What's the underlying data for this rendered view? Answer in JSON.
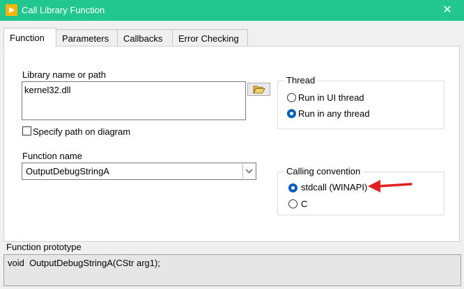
{
  "window": {
    "title": "Call Library Function",
    "close_glyph": "✕"
  },
  "tabs": [
    {
      "label": "Function",
      "active": true
    },
    {
      "label": "Parameters",
      "active": false
    },
    {
      "label": "Callbacks",
      "active": false
    },
    {
      "label": "Error Checking",
      "active": false
    }
  ],
  "function_tab": {
    "library": {
      "label": "Library name or path",
      "value": "kernel32.dll"
    },
    "specify_path": {
      "label": "Specify path on diagram",
      "checked": false
    },
    "function_name": {
      "label": "Function name",
      "value": "OutputDebugStringA"
    },
    "thread": {
      "title": "Thread",
      "options": [
        {
          "label": "Run in UI thread",
          "checked": false
        },
        {
          "label": "Run in any thread",
          "checked": true
        }
      ]
    },
    "calling_convention": {
      "title": "Calling convention",
      "options": [
        {
          "label": "stdcall (WINAPI)",
          "checked": true
        },
        {
          "label": "C",
          "checked": false
        }
      ]
    }
  },
  "prototype": {
    "label": "Function prototype",
    "value": "void  OutputDebugStringA(CStr arg1);"
  },
  "colors": {
    "titlebar": "#22c68f",
    "annotation_arrow": "#e0201e",
    "radio_selected": "#005fb8"
  },
  "icons": {
    "app": "labview-play-icon",
    "browse": "folder-open-icon",
    "dropdown": "chevron-down-icon",
    "annotation": "red-arrow-icon"
  }
}
